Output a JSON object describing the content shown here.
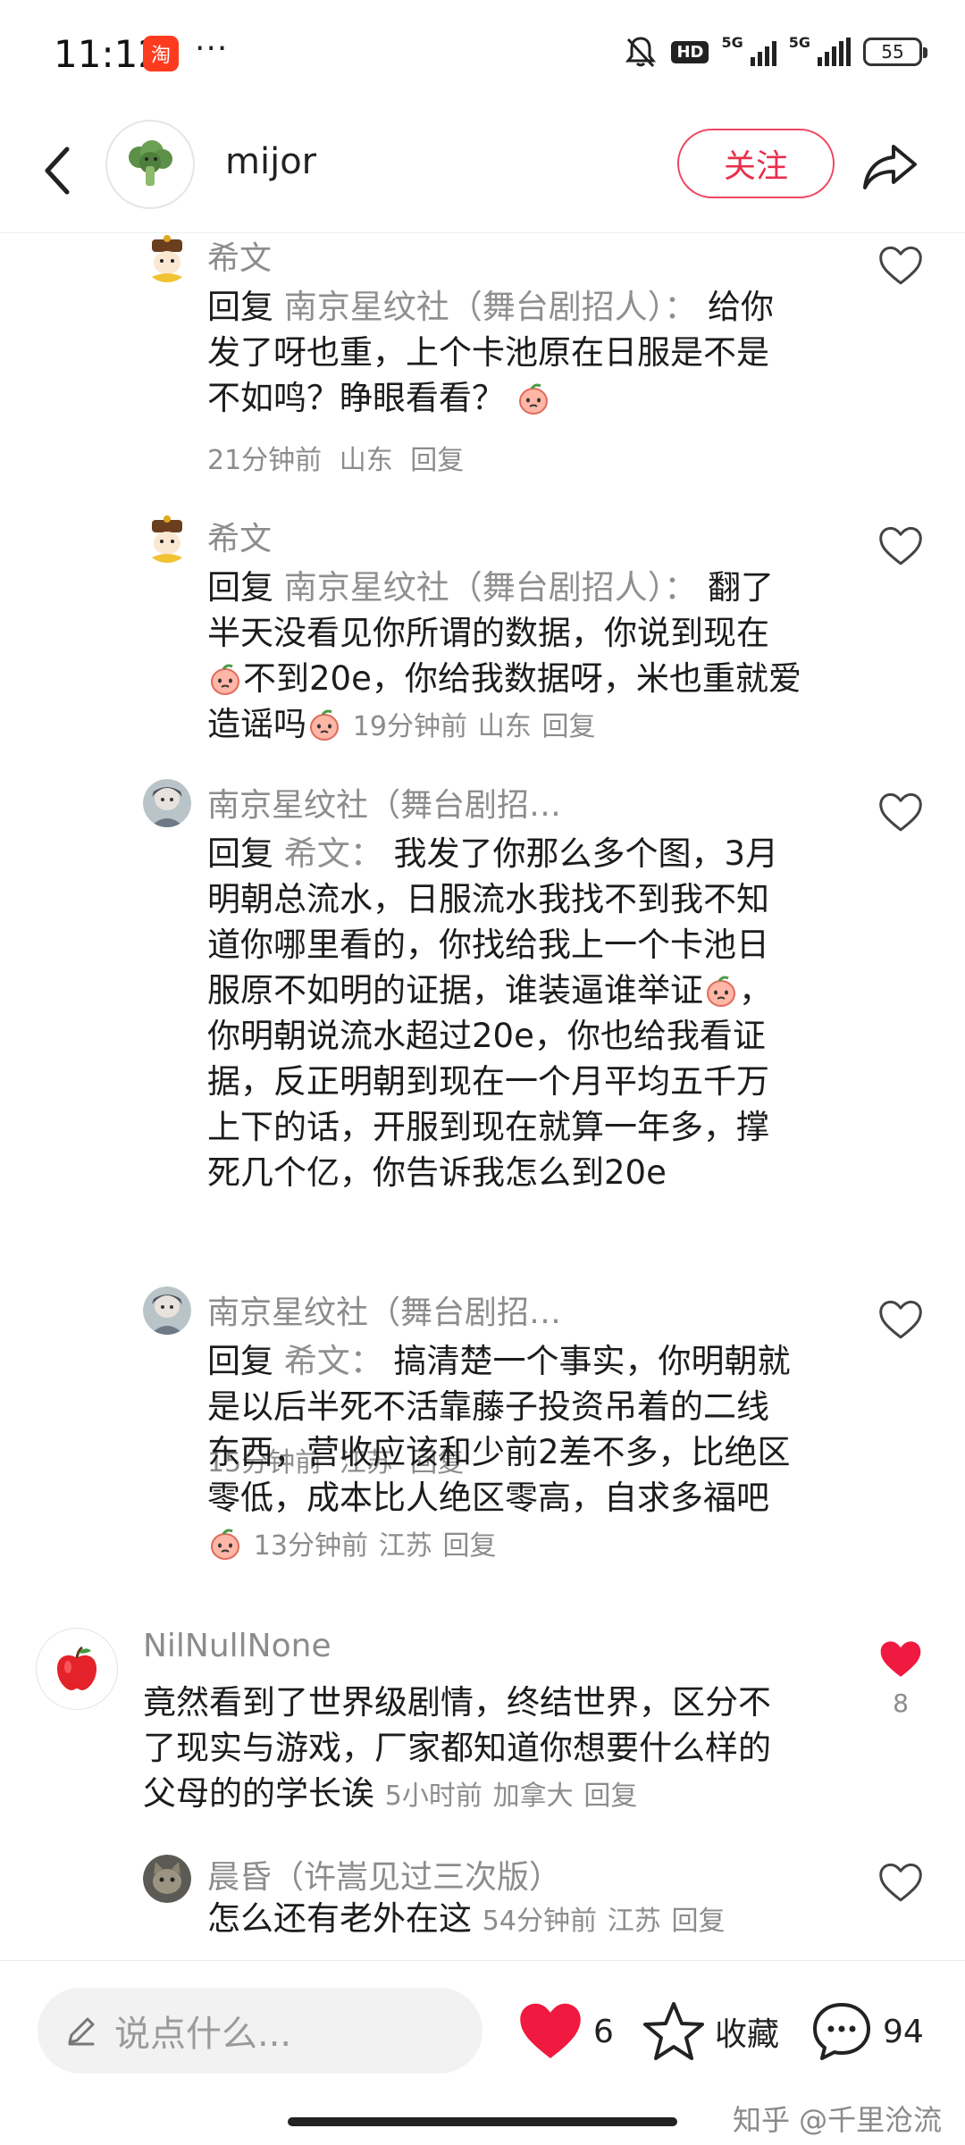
{
  "status_bar": {
    "time": "11:12",
    "app_icon_glyph": "淘",
    "dots": "···",
    "hd_label": "HD",
    "network_1": "5G",
    "network_2": "5G",
    "battery": "55"
  },
  "header": {
    "username": "mijor",
    "follow_label": "关注",
    "back_icon": "chevron-left-icon",
    "share_icon": "share-arrow-icon"
  },
  "comments": [
    {
      "author": "希文",
      "reply_word": "回复",
      "reply_target": "南京星纹社（舞台剧招人）：",
      "lines": [
        "给你",
        "发了呀也重，上个卡池原在日服是不是",
        "不如鸣？睁眼看看？"
      ],
      "time": "21分钟前",
      "location": "山东",
      "reply_label": "回复"
    },
    {
      "author": "希文",
      "reply_word": "回复",
      "reply_target": "南京星纹社（舞台剧招人）：",
      "lines": [
        "翻了",
        "半天没看见你所谓的数据，你说到现在",
        "不到20e，你给我数据呀，米也重就爱",
        "造谣吗"
      ],
      "time": "19分钟前",
      "location": "山东",
      "reply_label": "回复"
    },
    {
      "author": "南京星纹社（舞台剧招…",
      "reply_word": "回复",
      "reply_target": "希文：",
      "lines": [
        "我发了你那么多个图，3月",
        "明朝总流水，日服流水我找不到我不知",
        "道你哪里看的，你找给我上一个卡池日",
        "服原不如明的证据，谁装逼谁举证",
        "，",
        "你明朝说流水超过20e，你也给我看证",
        "据，反正明朝到现在一个月平均五千万",
        "上下的话，开服到现在就算一年多，撑",
        "死几个亿，你告诉我怎么到20e"
      ],
      "time": "15分钟前",
      "location": "江苏",
      "reply_label": "回复"
    },
    {
      "author": "南京星纹社（舞台剧招…",
      "reply_word": "回复",
      "reply_target": "希文：",
      "lines": [
        "搞清楚一个事实，你明朝就",
        "是以后半死不活靠藤子投资吊着的二线",
        "东西，营收应该和少前2差不多，比绝区",
        "零低，成本比人绝区零高，自求多福吧"
      ],
      "time": "13分钟前",
      "location": "江苏",
      "reply_label": "回复"
    },
    {
      "author": "NilNullNone",
      "lines": [
        "竟然看到了世界级剧情，终结世界，区分不",
        "了现实与游戏，厂家都知道你想要什么样的",
        "父母的的学长诶"
      ],
      "time": "5小时前",
      "location": "加拿大",
      "reply_label": "回复",
      "likes": "8"
    },
    {
      "author": "晨昏（许嵩见过三次版）",
      "lines": [
        "怎么还有老外在这"
      ],
      "time": "54分钟前",
      "location": "江苏",
      "reply_label": "回复"
    }
  ],
  "bottom_bar": {
    "input_placeholder": "说点什么...",
    "likes_count": "6",
    "collect_label": "收藏",
    "comments_count": "94"
  },
  "watermark": "知乎 @千里沧流",
  "colors": {
    "accent_red": "#e8304c",
    "like_red": "#f0193f",
    "muted_text": "#8c8c8c"
  }
}
